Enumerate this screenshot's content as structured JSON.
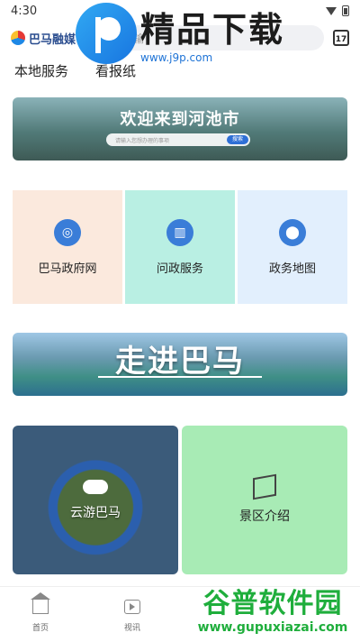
{
  "status_bar": {
    "time": "4:30"
  },
  "header": {
    "logo_text": "巴马融媒",
    "search_placeholder": "请输",
    "calendar_day": "17"
  },
  "watermark_top": {
    "title": "精品下载",
    "url": "www.j9p.com"
  },
  "tabs": [
    "本地服务",
    "看报纸"
  ],
  "hechi_banner": {
    "title": "欢迎来到河池市",
    "search_placeholder": "请输入您想办理的事项",
    "search_button": "搜索"
  },
  "services": [
    {
      "label": "巴马政府网",
      "bg": "#fbe9dd",
      "icon": "globe-icon",
      "glyph": "◎"
    },
    {
      "label": "问政服务",
      "bg": "#b9efe3",
      "icon": "building-icon",
      "glyph": "▥"
    },
    {
      "label": "政务地图",
      "bg": "#e2effd",
      "icon": "location-pin-icon",
      "glyph": "⬤"
    }
  ],
  "bama_banner": {
    "title": "走进巴马"
  },
  "tiles": [
    {
      "label": "云游巴马"
    },
    {
      "label": "景区介绍"
    }
  ],
  "bottom_nav": [
    {
      "label": "首页"
    },
    {
      "label": "视讯"
    }
  ],
  "watermark_bottom": {
    "title": "谷普软件园",
    "url": "www.gupuxiazai.com"
  }
}
